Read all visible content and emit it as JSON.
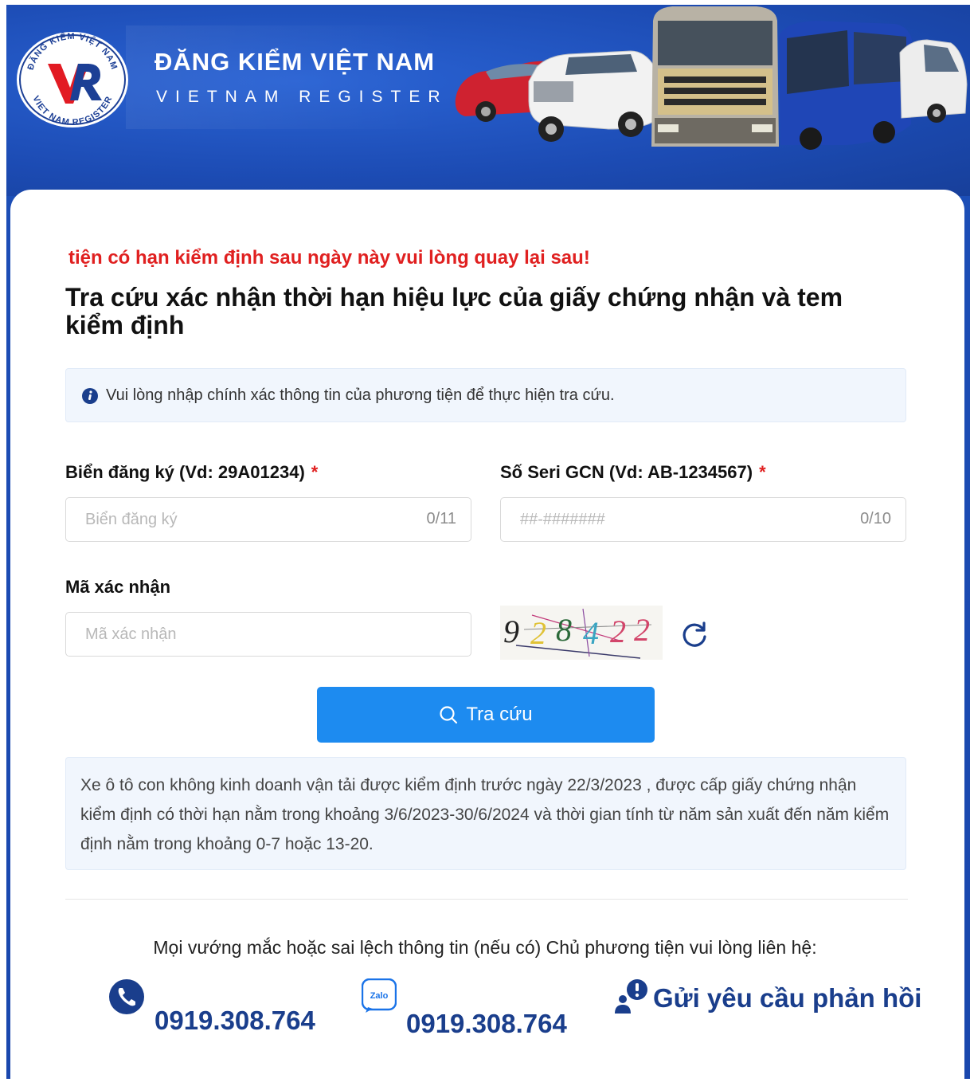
{
  "header": {
    "brand_title": "ĐĂNG KIỂM VIỆT NAM",
    "brand_subtitle": "VIETNAM REGISTER",
    "logo_ring_text": "ĐĂNG KIỂM VIỆT NAM • VIET NAM REGISTER",
    "logo_icon": "vr-logo-icon"
  },
  "form": {
    "notice": "tiện có hạn kiểm định sau ngày này vui lòng quay lại sau!",
    "title": "Tra cứu xác nhận thời hạn hiệu lực của giấy chứng nhận và tem kiểm định",
    "info_text": "Vui lòng nhập chính xác thông tin của phương tiện để thực hiện tra cứu.",
    "plate": {
      "label": "Biển đăng ký (Vd: 29A01234)",
      "required_mark": "*",
      "placeholder": "Biển đăng ký",
      "value": "",
      "counter": "0/11"
    },
    "serial": {
      "label": "Số Seri GCN (Vd: AB-1234567)",
      "required_mark": "*",
      "placeholder": "##-#######",
      "value": "",
      "counter": "0/10"
    },
    "captcha": {
      "label": "Mã xác nhận",
      "placeholder": "Mã xác nhận",
      "value": "",
      "digits": [
        "9",
        "2",
        "8",
        "4",
        "2",
        "2"
      ]
    },
    "submit_label": "Tra cứu",
    "note": "Xe ô tô con không kinh doanh vận tải được kiểm định trước ngày 22/3/2023 , được cấp giấy chứng nhận kiểm định có thời hạn nằm trong khoảng 3/6/2023-30/6/2024 và thời gian tính từ năm sản xuất đến năm kiểm định nằm trong khoảng 0-7 hoặc 13-20."
  },
  "footer": {
    "contact_text": "Mọi vướng mắc hoặc sai lệch thông tin (nếu có) Chủ phương tiện vui lòng liên hệ:",
    "phone": "0919.308.764",
    "zalo_label": "Zalo",
    "zalo": "0919.308.764",
    "feedback": "Gửi yêu cầu phản hồi"
  },
  "colors": {
    "header_blue": "#1c4bb3",
    "button_blue": "#1d8bf0",
    "notice_red": "#e02020",
    "contact_blue": "#1a3e8c"
  }
}
